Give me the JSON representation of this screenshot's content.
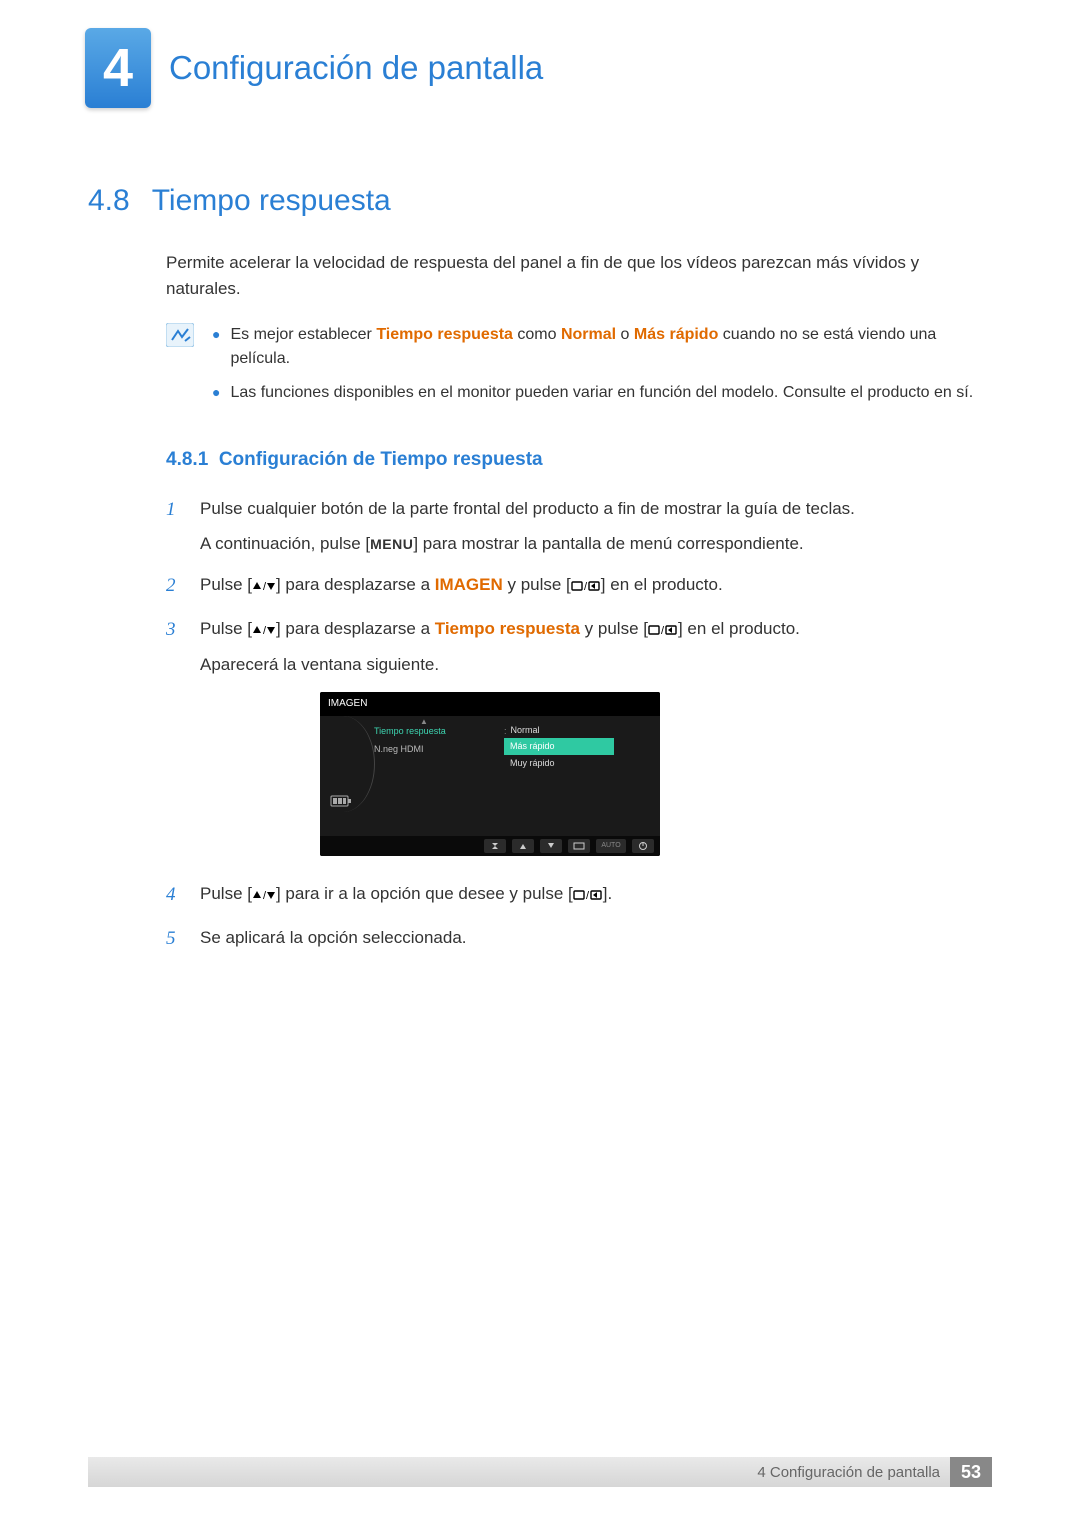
{
  "chapter": {
    "number": "4",
    "title": "Configuración de pantalla"
  },
  "section": {
    "number": "4.8",
    "title": "Tiempo respuesta",
    "intro": "Permite acelerar la velocidad de respuesta del panel a fin de que los vídeos parezcan más vívidos y naturales."
  },
  "notes": [
    {
      "pre": "Es mejor establecer ",
      "hl1": "Tiempo respuesta",
      "mid": " como ",
      "hl2": "Normal",
      "mid2": " o ",
      "hl3": "Más rápido",
      "post": " cuando no se está viendo una película."
    },
    {
      "plain": "Las funciones disponibles en el monitor pueden variar en función del modelo. Consulte el producto en sí."
    }
  ],
  "subsection": {
    "number": "4.8.1",
    "title": "Configuración de Tiempo respuesta"
  },
  "menu_key": "MENU",
  "steps": {
    "1": {
      "line1": "Pulse cualquier botón de la parte frontal del producto a fin de mostrar la guía de teclas.",
      "line2a": "A continuación, pulse [",
      "line2b": "] para mostrar la pantalla de menú correspondiente."
    },
    "2": {
      "pre": "Pulse [",
      "mid": "] para desplazarse a ",
      "hl": "IMAGEN",
      "post1": " y pulse [",
      "post2": "] en el producto."
    },
    "3": {
      "pre": "Pulse [",
      "mid": "] para desplazarse a ",
      "hl": "Tiempo respuesta",
      "post1": " y pulse [",
      "post2": "] en el producto.",
      "sub": "Aparecerá la ventana siguiente."
    },
    "4": {
      "pre": "Pulse [",
      "mid": "] para ir a la opción que desee y pulse [",
      "post": "]."
    },
    "5": {
      "text": "Se aplicará la opción seleccionada."
    }
  },
  "osd": {
    "title": "IMAGEN",
    "left": [
      "Tiempo respuesta",
      "N.neg HDMI"
    ],
    "options": [
      "Normal",
      "Más rápido",
      "Muy rápido"
    ],
    "selected_index": 1,
    "auto": "AUTO"
  },
  "footer": {
    "text": "4 Configuración de pantalla",
    "page": "53"
  }
}
